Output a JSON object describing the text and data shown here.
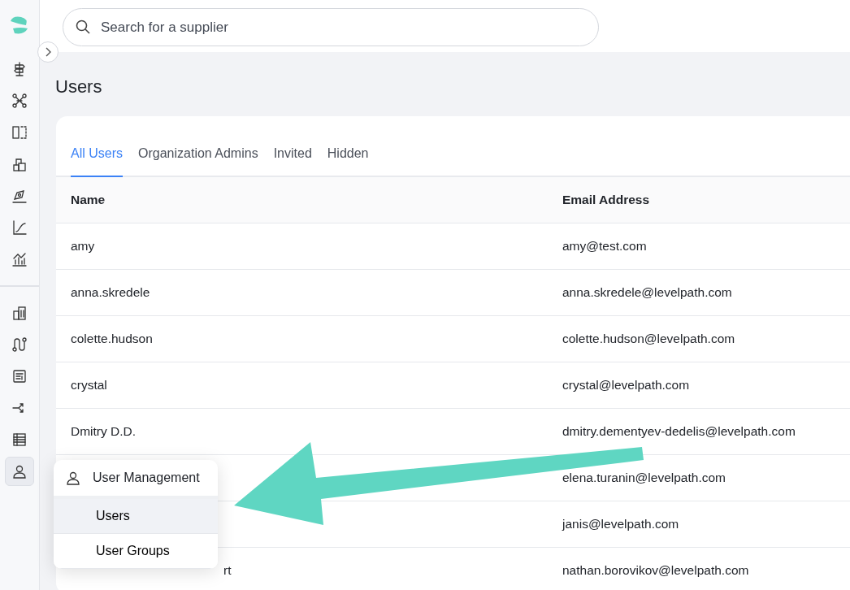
{
  "search": {
    "placeholder": "Search for a supplier"
  },
  "sidebar": {
    "groups": [
      {
        "items": [
          {
            "selected": false
          },
          {
            "selected": false
          },
          {
            "selected": false
          },
          {
            "selected": false
          },
          {
            "selected": false
          },
          {
            "selected": false
          },
          {
            "selected": false
          }
        ]
      },
      {
        "items": [
          {
            "selected": false
          },
          {
            "selected": false
          },
          {
            "selected": false
          },
          {
            "selected": false
          },
          {
            "selected": false
          },
          {
            "selected": true
          }
        ]
      }
    ]
  },
  "page_title": "Users",
  "tabs": [
    {
      "label": "All Users",
      "selected": true
    },
    {
      "label": "Organization Admins",
      "selected": false
    },
    {
      "label": "Invited",
      "selected": false
    },
    {
      "label": "Hidden",
      "selected": false
    }
  ],
  "table": {
    "columns": [
      "Name",
      "Email Address"
    ],
    "rows": [
      {
        "name": "amy",
        "email": "amy@test.com"
      },
      {
        "name": "anna.skredele",
        "email": "anna.skredele@levelpath.com"
      },
      {
        "name": "colette.hudson",
        "email": "colette.hudson@levelpath.com"
      },
      {
        "name": "crystal",
        "email": "crystal@levelpath.com"
      },
      {
        "name": "Dmitry D.D.",
        "email": "dmitry.dementyev-dedelis@levelpath.com"
      },
      {
        "email": "elena.turanin@levelpath.com"
      },
      {
        "email": "janis@levelpath.com"
      },
      {
        "name": "rt",
        "kind": "covered",
        "email": "nathan.borovikov@levelpath.com"
      }
    ]
  },
  "user_menu": {
    "title": "User Management",
    "items": [
      {
        "label": "Users",
        "selected": true
      },
      {
        "label": "User Groups",
        "selected": false
      }
    ]
  },
  "annotation": {
    "kind": "arrow"
  }
}
